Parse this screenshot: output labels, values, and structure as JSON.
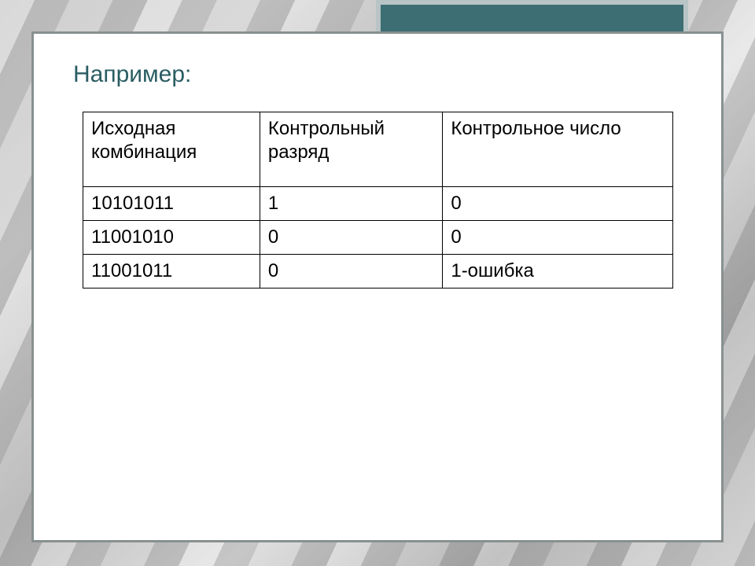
{
  "slide": {
    "title": "Например:",
    "table": {
      "headers": [
        "Исходная комбинация",
        "Контрольный разряд",
        "Контрольное число"
      ],
      "rows": [
        [
          "10101011",
          "1",
          "0"
        ],
        [
          "11001010",
          "0",
          "0"
        ],
        [
          "11001011",
          "0",
          "1-ошибка"
        ]
      ]
    }
  }
}
